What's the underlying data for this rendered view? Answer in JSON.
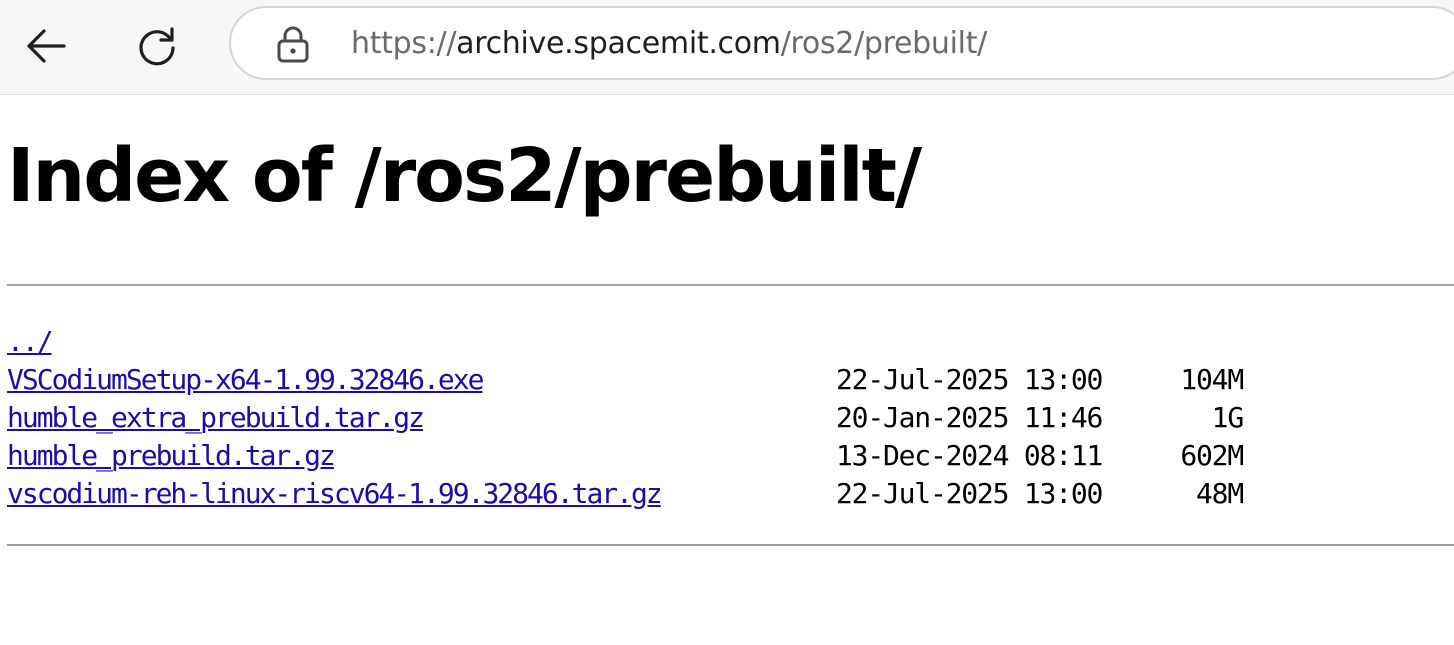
{
  "browser": {
    "url": {
      "scheme": "https://",
      "host": "archive.spacemit.com",
      "path": "/ros2/prebuilt/"
    }
  },
  "page": {
    "title": "Index of /ros2/prebuilt/",
    "entries": [
      {
        "name": "../",
        "date": "",
        "size": ""
      },
      {
        "name": "VSCodiumSetup-x64-1.99.32846.exe",
        "date": "22-Jul-2025 13:00",
        "size": "104M"
      },
      {
        "name": "humble_extra_prebuild.tar.gz",
        "date": "20-Jan-2025 11:46",
        "size": "1G"
      },
      {
        "name": "humble_prebuild.tar.gz",
        "date": "13-Dec-2024 08:11",
        "size": "602M"
      },
      {
        "name": "vscodium-reh-linux-riscv64-1.99.32846.tar.gz",
        "date": "22-Jul-2025 13:00",
        "size": "48M"
      }
    ]
  },
  "icons": {
    "back": "back-arrow-icon",
    "reload": "reload-icon",
    "lock": "lock-icon"
  }
}
